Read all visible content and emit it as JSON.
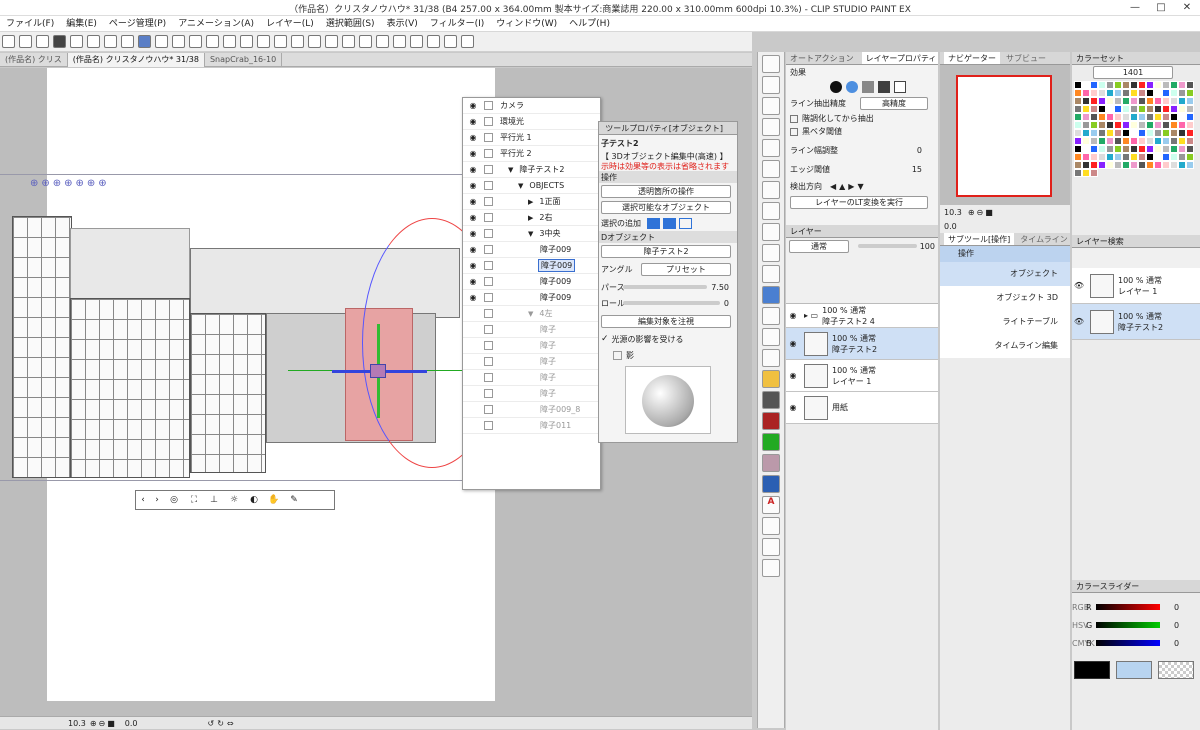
{
  "window": {
    "title": "（作品名）クリスタノウハウ* 31/38 (B4 257.00 x 364.00mm 製本サイズ:商業誌用 220.00 x 310.00mm 600dpi 10.3%) - CLIP STUDIO PAINT EX",
    "minimize": "—",
    "maximize": "□",
    "close": "✕"
  },
  "menu": [
    "ファイル(F)",
    "編集(E)",
    "ページ管理(P)",
    "アニメーション(A)",
    "レイヤー(L)",
    "選択範囲(S)",
    "表示(V)",
    "フィルター(I)",
    "ウィンドウ(W)",
    "ヘルプ(H)"
  ],
  "tabs": [
    "(作品名) クリス",
    "(作品名) クリスタノウハウ* 31/38",
    "SnapCrab_16-10"
  ],
  "status": {
    "zoom": "10.3",
    "angle": "0.0"
  },
  "object_list": {
    "items": [
      {
        "label": "カメラ",
        "eye": true,
        "indent": 0
      },
      {
        "label": "環境光",
        "eye": true,
        "indent": 0
      },
      {
        "label": "平行光 1",
        "eye": true,
        "indent": 0
      },
      {
        "label": "平行光 2",
        "eye": true,
        "indent": 0
      },
      {
        "label": "障子テスト2",
        "eye": true,
        "indent": 1,
        "arrow": "▼"
      },
      {
        "label": "OBJECTS",
        "eye": true,
        "indent": 2,
        "arrow": "▼"
      },
      {
        "label": "1正面",
        "eye": true,
        "indent": 3,
        "arrow": "▶"
      },
      {
        "label": "2右",
        "eye": true,
        "indent": 3,
        "arrow": "▶"
      },
      {
        "label": "3中央",
        "eye": true,
        "indent": 3,
        "arrow": "▼"
      },
      {
        "label": "障子009",
        "eye": true,
        "indent": 4
      },
      {
        "label": "障子009",
        "eye": true,
        "indent": 4,
        "selected": true
      },
      {
        "label": "障子009",
        "eye": true,
        "indent": 4
      },
      {
        "label": "障子009",
        "eye": true,
        "indent": 4
      },
      {
        "label": "4左",
        "eye": false,
        "indent": 3,
        "arrow": "▼",
        "dim": true
      },
      {
        "label": "障子",
        "eye": false,
        "indent": 4,
        "dim": true
      },
      {
        "label": "障子",
        "eye": false,
        "indent": 4,
        "dim": true
      },
      {
        "label": "障子",
        "eye": false,
        "indent": 4,
        "dim": true
      },
      {
        "label": "障子",
        "eye": false,
        "indent": 4,
        "dim": true
      },
      {
        "label": "障子",
        "eye": false,
        "indent": 4,
        "dim": true
      },
      {
        "label": "障子009_8",
        "eye": false,
        "indent": 4,
        "dim": true
      },
      {
        "label": "障子011",
        "eye": false,
        "indent": 4,
        "dim": true
      }
    ]
  },
  "tool_property": {
    "header": "ツールプロパティ[オブジェクト]",
    "name": "子テスト2",
    "mode": "【 3Dオブジェクト編集中(高速) 】",
    "warning": "示時は効果等の表示は省略されます",
    "operation_label": "操作",
    "transparent_op": "透明箇所の操作",
    "selectable": "選択可能なオブジェクト",
    "selection_add_label": "選択の追加",
    "obj3d_label": "Dオブジェクト",
    "obj3d_value": "障子テスト2",
    "angle_label": "アングル",
    "preset": "プリセット",
    "perspective_label": "パース",
    "perspective_value": "7.50",
    "roll_label": "ロール",
    "roll_value": "0",
    "focus_btn": "編集対象を注視",
    "light_label": "光源の影響を受ける",
    "shadow_label": "影"
  },
  "effect_panel": {
    "tab1": "オートアクション",
    "tab2": "レイヤープロパティ",
    "effect_label": "効果",
    "precision_label": "ライン抽出精度",
    "precision_value": "高精度",
    "grad_extract": "階調化してから抽出",
    "black_fill": "黒ベタ閾値",
    "line_width_label": "ライン幅調整",
    "line_width_value": "0",
    "edge_label": "エッジ閾値",
    "edge_value": "15",
    "direction_label": "検出方向",
    "convert_btn": "レイヤーのLT変換を実行"
  },
  "navigator": {
    "tab1": "ナビゲーター",
    "tab2": "サブビュー",
    "zoom": "10.3",
    "angle": "0.0"
  },
  "layer_panel": {
    "tab": "レイヤー",
    "blend": "通常",
    "opacity": "100",
    "layers": [
      {
        "meta": "100 % 通常",
        "name": "障子テスト2 4",
        "type": "folder"
      },
      {
        "meta": "100 % 通常",
        "name": "障子テスト2",
        "type": "3d",
        "selected": true
      },
      {
        "meta": "100 % 通常",
        "name": "レイヤー 1",
        "type": "raster"
      },
      {
        "meta": "",
        "name": "用紙",
        "type": "paper"
      }
    ]
  },
  "subtool_panel": {
    "tab1": "サブツール[操作]",
    "tab2": "タイムライン",
    "header": "操作",
    "items": [
      "オブジェクト",
      "オブジェクト 3D",
      "ライトテーブル",
      "タイムライン編集"
    ]
  },
  "color_set": {
    "tab": "カラーセット",
    "preset": "1401"
  },
  "layer_search": {
    "tab": "レイヤー検索",
    "rows": [
      {
        "meta": "100 % 通常",
        "name": "レイヤー 1"
      },
      {
        "meta": "100 % 通常",
        "name": "障子テスト2"
      }
    ]
  },
  "color_slider": {
    "tab": "カラースライダー",
    "r": "0",
    "g": "0",
    "b": "0",
    "modes": [
      "RGB",
      "HSV",
      "CMYK"
    ]
  },
  "colors": {
    "accent": "#3a6fcf",
    "warning": "#e0201a",
    "selected_row": "#cfe0f5",
    "pink_panel": "#e7a3a3"
  }
}
